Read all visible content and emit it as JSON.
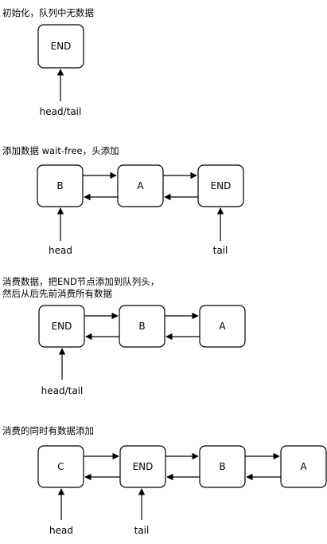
{
  "diagrams": [
    {
      "caption_lines": [
        "初始化，队列中无数据"
      ],
      "nodes": [
        "END"
      ],
      "pointers": [
        "head/tail"
      ]
    },
    {
      "caption_lines": [
        "添加数据 wait-free，头添加"
      ],
      "nodes": [
        "B",
        "A",
        "END"
      ],
      "pointers": [
        "head",
        "tail"
      ]
    },
    {
      "caption_lines": [
        "消费数据，把END节点添加到队列头，",
        "然后从后先前消费所有数据"
      ],
      "nodes": [
        "END",
        "B",
        "A"
      ],
      "pointers": [
        "head/tail"
      ]
    },
    {
      "caption_lines": [
        "消费的同时有数据添加"
      ],
      "nodes": [
        "C",
        "END",
        "B",
        "A"
      ],
      "pointers": [
        "head",
        "tail"
      ]
    }
  ]
}
